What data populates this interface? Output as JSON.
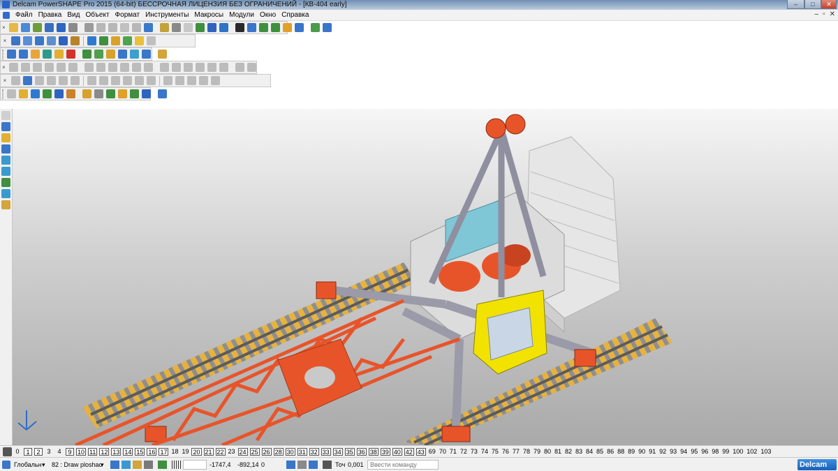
{
  "window": {
    "title": "Delcam PowerSHAPE Pro 2015 (64-bit) БЕССРОЧНАЯ ЛИЦЕНЗИЯ БЕЗ ОГРАНИЧЕНИЙ - [КВ-404 early]",
    "minimize": "–",
    "maximize": "□",
    "close": "✕"
  },
  "menu": {
    "items": [
      "Файл",
      "Правка",
      "Вид",
      "Объект",
      "Формат",
      "Инструменты",
      "Макросы",
      "Модули",
      "Окно",
      "Справка"
    ],
    "mdi_min": "–",
    "mdi_restore": "▫",
    "mdi_close": "✕"
  },
  "toolbars": {
    "close_glyph": "×",
    "row1_icon_colors": [
      "#e6b84a",
      "#4a8ad6",
      "#6c9c3c",
      "#3a6fc0",
      "#2d66c2",
      "#8a8a8a",
      "#9b9b9b",
      "#b7b7b7",
      "#b7b7b7",
      "#c0c0c0",
      "#b7b7b7",
      "#3b7ac9",
      "#c3a23a",
      "#8a8a8a",
      "#c8c8c8",
      "#3f8f3f",
      "#2f63c0",
      "#2e74c8",
      "#2a2a2a",
      "#3a76c9",
      "#3f8f3f",
      "#3f8f3f",
      "#e0a02a",
      "#3a76c9",
      "#4c9b4c",
      "#3a76c9"
    ],
    "row2_icon_colors": [
      "#3b76c6",
      "#5a8ed6",
      "#3a76c9",
      "#5c8fd0",
      "#2f63c0",
      "#b9822a",
      "#2f7ad0",
      "#3f8f3f",
      "#dba22a",
      "#4fa34f",
      "#e8c03a",
      "#c0c0c0"
    ],
    "row3_icon_colors": [
      "#3a76c9",
      "#3a76c9",
      "#e8a63a",
      "#2f9a8a",
      "#e0b030",
      "#d3322a",
      "#3f8f3f",
      "#4f9f4f",
      "#d7a12c",
      "#3a76c9",
      "#3aa0d0",
      "#3a76c9",
      "#d3a53a"
    ],
    "row4_icon_colors": [
      "#bcbcbc",
      "#bcbcbc",
      "#bcbcbc",
      "#bcbcbc",
      "#bcbcbc",
      "#bcbcbc",
      "#bcbcbc",
      "#bcbcbc",
      "#bcbcbc",
      "#bcbcbc",
      "#bcbcbc",
      "#bcbcbc",
      "#bcbcbc",
      "#bcbcbc",
      "#bcbcbc",
      "#bcbcbc",
      "#bcbcbc",
      "#bcbcbc",
      "#bcbcbc",
      "#bcbcbc"
    ],
    "row5_icon_colors": [
      "#bcbcbc",
      "#3a76c9",
      "#bcbcbc",
      "#bcbcbc",
      "#bcbcbc",
      "#bcbcbc",
      "#bcbcbc",
      "#bcbcbc",
      "#bcbcbc",
      "#bcbcbc",
      "#bcbcbc",
      "#bcbcbc",
      "#bcbcbc",
      "#bcbcbc",
      "#bcbcbc",
      "#bcbcbc",
      "#bcbcbc"
    ],
    "row6_icon_colors": [
      "#bcbcbc",
      "#e0b030",
      "#2f7ad0",
      "#3f8f3f",
      "#2f63c0",
      "#c9822a",
      "#d7a12c",
      "#8a8a8a",
      "#3f8f3f",
      "#e0a02a",
      "#3f8f3f",
      "#2f63c0",
      "#3a76c9"
    ],
    "left_icon_colors": [
      "#d0d0d0",
      "#3a76c9",
      "#e0b030",
      "#3a76c9",
      "#3a9ad0",
      "#3a9ad0",
      "#3f8f3f",
      "#3a9ad0",
      "#d3a53a"
    ]
  },
  "levels": {
    "numbers": [
      "0",
      "1",
      "2",
      "3",
      "4",
      "9",
      "10",
      "11",
      "12",
      "13",
      "14",
      "15",
      "16",
      "17",
      "18",
      "19",
      "20",
      "21",
      "22",
      "23",
      "24",
      "25",
      "26",
      "28",
      "30",
      "31",
      "32",
      "33",
      "34",
      "35",
      "36",
      "38",
      "39",
      "40",
      "42",
      "43",
      "69",
      "70",
      "71",
      "72",
      "73",
      "74",
      "75",
      "76",
      "77",
      "78",
      "79",
      "80",
      "81",
      "82",
      "83",
      "84",
      "85",
      "86",
      "88",
      "89",
      "90",
      "91",
      "92",
      "93",
      "94",
      "95",
      "96",
      "98",
      "99",
      "100",
      "102",
      "103"
    ],
    "active": [
      "1",
      "2",
      "9",
      "10",
      "11",
      "12",
      "13",
      "14",
      "15",
      "16",
      "17",
      "20",
      "21",
      "22",
      "24",
      "25",
      "26",
      "28",
      "30",
      "31",
      "32",
      "33",
      "34",
      "35",
      "36",
      "38",
      "39",
      "40",
      "42",
      "43"
    ]
  },
  "status": {
    "workplane": "Глобальн",
    "level_name": "82 : Draw ploshac",
    "x": "-1747,4",
    "y": "-892,14",
    "z": "0",
    "tolerance_label": "Точ",
    "tolerance": "0,001",
    "command_placeholder": "Ввести команду",
    "brand": "Delcam"
  },
  "colors": {
    "structure": "#e8542a",
    "steel": "#9a9aa8",
    "counterweight": "#e4e4e4",
    "cabin": "#f2e200",
    "rail_tie": "#e8b13a",
    "panel": "#7fc6d6"
  }
}
